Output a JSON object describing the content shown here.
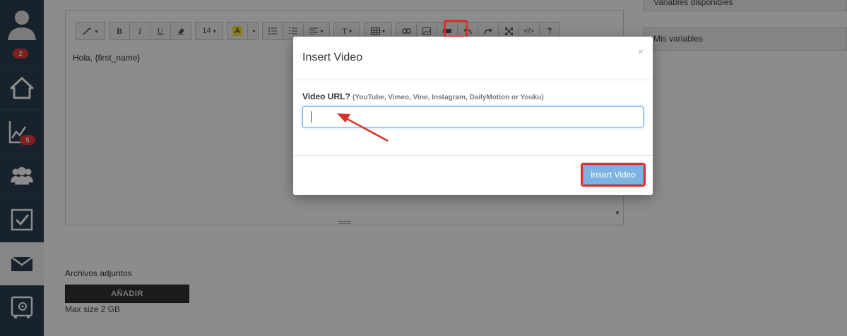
{
  "sidebar": {
    "user_badge": "2",
    "stats_badge": "5",
    "items": [
      {
        "name": "home",
        "label": "home-icon"
      },
      {
        "name": "stats",
        "label": "chart-icon"
      },
      {
        "name": "contacts",
        "label": "users-icon"
      },
      {
        "name": "tasks",
        "label": "checkbox-icon"
      },
      {
        "name": "email",
        "label": "mail-icon"
      },
      {
        "name": "vault",
        "label": "safe-icon"
      }
    ]
  },
  "editor": {
    "content": "Hola, {first_name}",
    "font_size": "14",
    "toolbar_text_style": "T",
    "help": "?",
    "code": "</>"
  },
  "right_panel": {
    "available_vars": "Variables disponibles",
    "my_vars": "Mis variables"
  },
  "attachments": {
    "label": "Archivos adjuntos",
    "add_button": "AÑADIR",
    "max_size": "Max size 2 GB"
  },
  "modal": {
    "title": "Insert Video",
    "close": "×",
    "field_label": "Video URL?",
    "field_hint": "(YouTube, Vimeo, Vine, Instagram, DailyMotion or Youku)",
    "input_value": "",
    "submit": "Insert Video"
  },
  "colors": {
    "sidebar": "#2c3e50",
    "highlight": "#d9312c",
    "button": "#7db3e0",
    "badge": "#e23b3b"
  }
}
